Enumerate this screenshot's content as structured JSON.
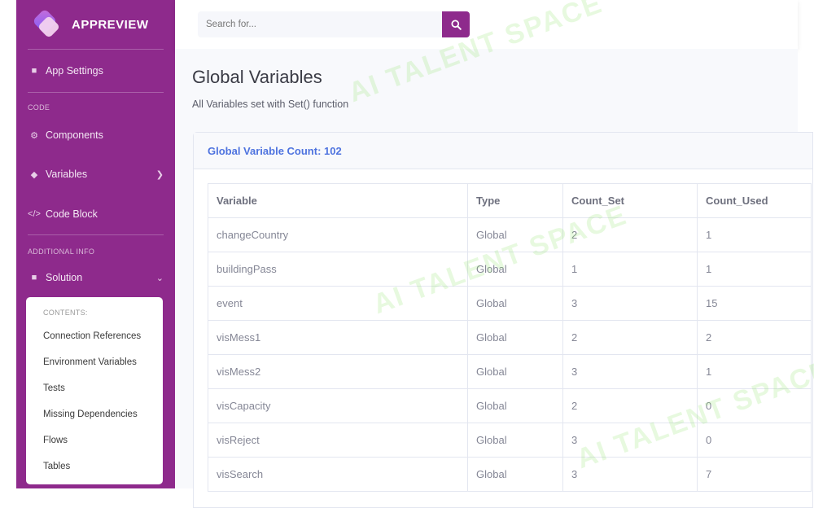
{
  "brand": {
    "name": "APPREVIEW"
  },
  "sidebar": {
    "app_settings": "App Settings",
    "section_code": "CODE",
    "components": "Components",
    "variables": "Variables",
    "code_block": "Code Block",
    "section_additional": "ADDITIONAL INFO",
    "solution": "Solution",
    "submenu": {
      "label": "CONTENTS:",
      "items": [
        "Connection References",
        "Environment Variables",
        "Tests",
        "Missing Dependencies",
        "Flows",
        "Tables"
      ]
    }
  },
  "search": {
    "placeholder": "Search for..."
  },
  "page": {
    "title": "Global Variables",
    "subtitle": "All Variables set with Set() function",
    "card_header": "Global Variable Count: 102"
  },
  "table": {
    "headers": [
      "Variable",
      "Type",
      "Count_Set",
      "Count_Used"
    ],
    "rows": [
      [
        "changeCountry",
        "Global",
        "2",
        "1"
      ],
      [
        "buildingPass",
        "Global",
        "1",
        "1"
      ],
      [
        "event",
        "Global",
        "3",
        "15"
      ],
      [
        "visMess1",
        "Global",
        "2",
        "2"
      ],
      [
        "visMess2",
        "Global",
        "3",
        "1"
      ],
      [
        "visCapacity",
        "Global",
        "2",
        "0"
      ],
      [
        "visReject",
        "Global",
        "3",
        "0"
      ],
      [
        "visSearch",
        "Global",
        "3",
        "7"
      ]
    ]
  },
  "watermark": "AI TALENT SPACE",
  "colors": {
    "accent": "#8e2a8c",
    "link": "#4e73df",
    "background": "#f8f9fc"
  }
}
